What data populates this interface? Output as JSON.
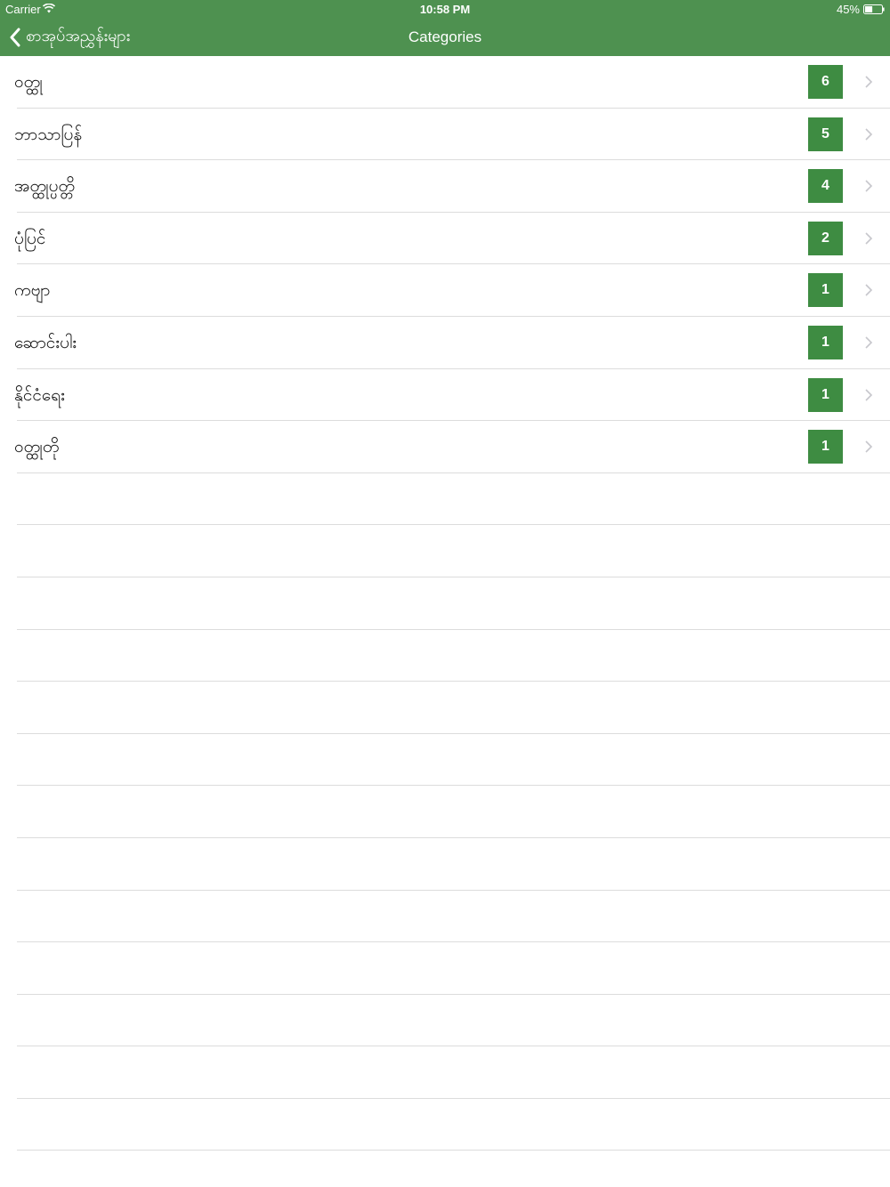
{
  "status_bar": {
    "carrier": "Carrier",
    "time": "10:58 PM",
    "battery_percent": "45%",
    "battery_level": 0.45
  },
  "nav": {
    "back_label": "စာအုပ်အညွှန်းများ",
    "title": "Categories"
  },
  "categories": [
    {
      "label": "ဝတ္ထု",
      "count": "6"
    },
    {
      "label": "ဘာသာပြန်",
      "count": "5"
    },
    {
      "label": "အတ္ထုပ္ပတ္တိ",
      "count": "4"
    },
    {
      "label": "ပုံပြင်",
      "count": "2"
    },
    {
      "label": "ကဗျာ",
      "count": "1"
    },
    {
      "label": "ဆောင်းပါး",
      "count": "1"
    },
    {
      "label": "နိုင်ငံရေး",
      "count": "1"
    },
    {
      "label": "ဝတ္ထုတို",
      "count": "1"
    }
  ],
  "colors": {
    "nav_background": "#4e9150",
    "badge_background": "#3e8c42",
    "separator": "#dcdcdc"
  },
  "icons": [
    "wifi-icon",
    "battery-icon",
    "back-chevron-icon",
    "disclosure-chevron-icon"
  ]
}
